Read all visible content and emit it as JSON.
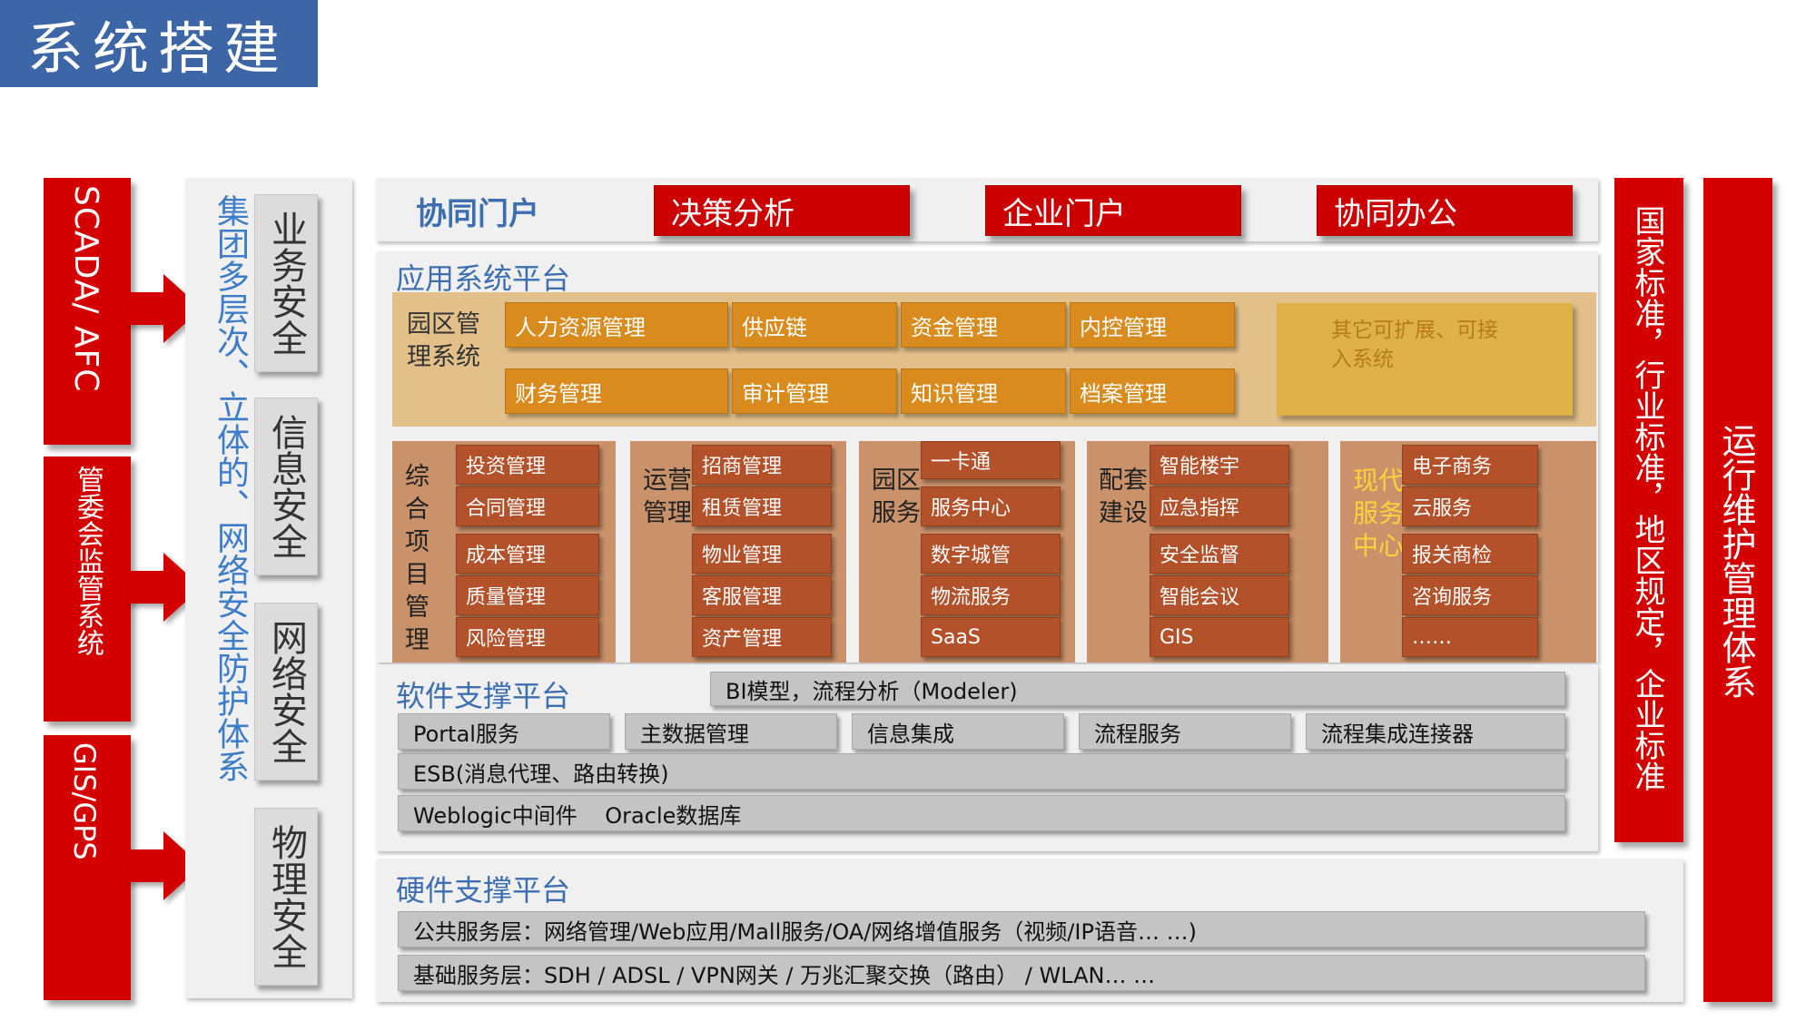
{
  "page_title": "系统搭建",
  "left_sources": [
    "SCADA/ AFC",
    "管委会监管系统",
    "GIS/GPS"
  ],
  "security": {
    "side_label": "集团多层次、立体的、网络安全防护体系",
    "items": [
      "业务安全",
      "信息安全",
      "网络安全",
      "物理安全"
    ]
  },
  "portal": {
    "label": "协同门户",
    "items": [
      "决策分析",
      "企业门户",
      "协同办公"
    ]
  },
  "app_platform": {
    "title": "应用系统平台",
    "park_label": "园区管理系统",
    "row1": [
      "人力资源管理",
      "供应链",
      "资金管理",
      "内控管理"
    ],
    "row2": [
      "财务管理",
      "审计管理",
      "知识管理",
      "档案管理"
    ],
    "ext": "其它可扩展、可接入系统",
    "groups": [
      {
        "label": "综合项目管理",
        "items": [
          "投资管理",
          "合同管理",
          "成本管理",
          "质量管理",
          "风险管理"
        ]
      },
      {
        "label": "运营管理",
        "items": [
          "招商管理",
          "租赁管理",
          "物业管理",
          "客服管理",
          "资产管理"
        ]
      },
      {
        "label": "园区服务",
        "items": [
          "一卡通",
          "服务中心",
          "数字城管",
          "物流服务",
          "SaaS"
        ]
      },
      {
        "label": "配套建设",
        "items": [
          "智能楼宇",
          "应急指挥",
          "安全监督",
          "智能会议",
          "GIS"
        ]
      },
      {
        "label": "现代服务中心",
        "items": [
          "电子商务",
          "云服务",
          "报关商检",
          "咨询服务",
          "……"
        ]
      }
    ]
  },
  "software_platform": {
    "title": "软件支撑平台",
    "bi": "BI模型，流程分析（Modeler)",
    "row": [
      "Portal服务",
      "主数据管理",
      "信息集成",
      "流程服务",
      "流程集成连接器"
    ],
    "esb": "ESB(消息代理、路由转换)",
    "middleware": "Weblogic中间件    Oracle数据库"
  },
  "hardware_platform": {
    "title": "硬件支撑平台",
    "public": "公共服务层：网络管理/Web应用/Mall服务/OA/网络增值服务（视频/IP语音… …)",
    "base": "基础服务层：SDH / ADSL / VPN网关 / 万兆汇聚交换（路由） / WLAN… …"
  },
  "right_bars": [
    "国家标准，行业标准，地区规定，企业标准",
    "运行维护管理体系"
  ],
  "colors": {
    "title_bg": "#3d66a6",
    "red": "#d40000",
    "blue_text": "#3d7cc9",
    "orange": "#d98b1e",
    "brown": "#b2512a"
  }
}
